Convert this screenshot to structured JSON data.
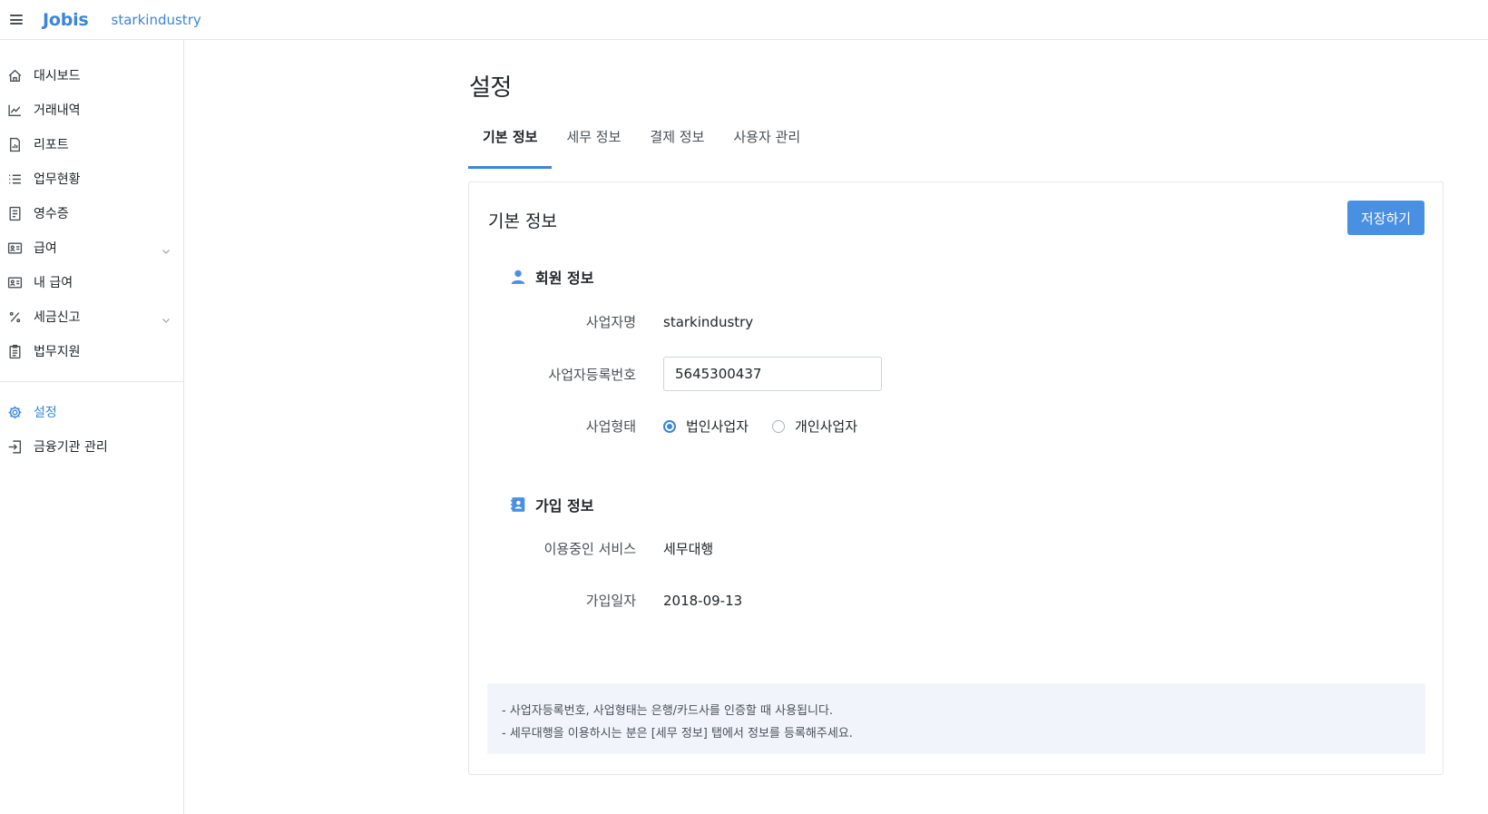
{
  "header": {
    "brand": "Jobis",
    "company": "starkindustry"
  },
  "sidebar": {
    "items": [
      {
        "label": "대시보드",
        "icon": "home-icon"
      },
      {
        "label": "거래내역",
        "icon": "chart-line-icon"
      },
      {
        "label": "리포트",
        "icon": "report-icon"
      },
      {
        "label": "업무현황",
        "icon": "list-icon"
      },
      {
        "label": "영수증",
        "icon": "receipt-icon"
      },
      {
        "label": "급여",
        "icon": "id-card-icon",
        "expandable": true
      },
      {
        "label": "내 급여",
        "icon": "id-card-icon"
      },
      {
        "label": "세금신고",
        "icon": "percent-icon",
        "expandable": true
      },
      {
        "label": "법무지원",
        "icon": "clipboard-icon"
      }
    ],
    "bottom_items": [
      {
        "label": "설정",
        "icon": "gear-icon",
        "active": true
      },
      {
        "label": "금융기관 관리",
        "icon": "sign-in-icon"
      }
    ]
  },
  "page": {
    "title": "설정",
    "tabs": [
      {
        "label": "기본 정보",
        "active": true
      },
      {
        "label": "세무 정보"
      },
      {
        "label": "결제 정보"
      },
      {
        "label": "사용자 관리"
      }
    ]
  },
  "card": {
    "title": "기본 정보",
    "save_label": "저장하기",
    "member_section": {
      "title": "회원 정보",
      "business_name_label": "사업자명",
      "business_name_value": "starkindustry",
      "reg_number_label": "사업자등록번호",
      "reg_number_value": "5645300437",
      "business_type_label": "사업형태",
      "business_type_options": [
        {
          "label": "법인사업자",
          "checked": true
        },
        {
          "label": "개인사업자",
          "checked": false
        }
      ]
    },
    "signup_section": {
      "title": "가입 정보",
      "service_label": "이용중인 서비스",
      "service_value": "세무대행",
      "join_date_label": "가입일자",
      "join_date_value": "2018-09-13"
    },
    "notice": [
      "- 사업자등록번호, 사업형태는 은행/카드사를 인증할 때 사용됩니다.",
      "- 세무대행을 이용하시는 분은 [세무 정보] 탭에서 정보를 등록해주세요."
    ]
  },
  "colors": {
    "accent": "#3a86d9",
    "button": "#4a90e2",
    "notice_bg": "#f1f5fb"
  }
}
